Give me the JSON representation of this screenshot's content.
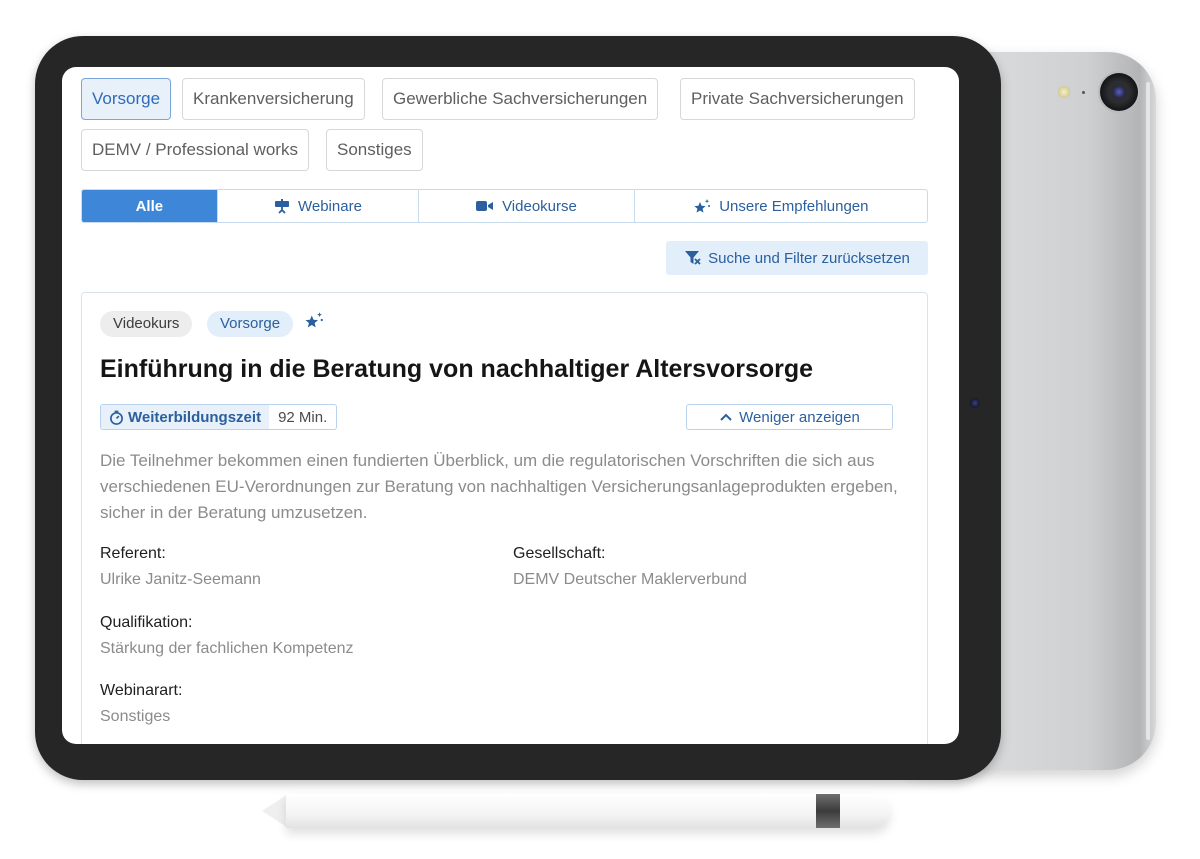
{
  "categories": [
    {
      "label": "Vorsorge",
      "active": true
    },
    {
      "label": "Krankenversicherung",
      "active": false
    },
    {
      "label": "Gewerbliche Sachversicherungen",
      "active": false
    },
    {
      "label": "Private Sachversicherungen",
      "active": false
    },
    {
      "label": "DEMV / Professional works",
      "active": false
    },
    {
      "label": "Sonstiges",
      "active": false
    }
  ],
  "tabs": [
    {
      "label": "Alle",
      "icon": "none",
      "active": true
    },
    {
      "label": "Webinare",
      "icon": "presentation-icon",
      "active": false
    },
    {
      "label": "Videokurse",
      "icon": "video-camera-icon",
      "active": false
    },
    {
      "label": "Unsere Empfehlungen",
      "icon": "sparkle-star-icon",
      "active": false
    }
  ],
  "reset_button": {
    "label": "Suche und Filter zurücksetzen",
    "icon": "filter-clear-icon"
  },
  "course": {
    "tags": [
      "Videokurs",
      "Vorsorge"
    ],
    "recommended_icon": "sparkle-star-icon",
    "title": "Einführung in die Beratung von nachhaltiger Altersvorsorge",
    "duration_label": "Weiterbildungszeit",
    "duration_value": "92 Min.",
    "toggle_label": "Weniger anzeigen",
    "description": "Die Teilnehmer bekommen einen fundierten Überblick, um die regulatorischen Vorschriften die sich aus verschiedenen EU-Verordnungen zur Beratung von nachhaltigen Versicherungsanlageprodukten ergeben, sicher in der Beratung umzusetzen.",
    "referent_label": "Referent:",
    "referent_value": "Ulrike Janitz-Seemann",
    "gesellschaft_label": "Gesellschaft:",
    "gesellschaft_value": "DEMV Deutscher Maklerverbund",
    "qualifikation_label": "Qualifikation:",
    "qualifikation_value": "Stärkung der fachlichen Kompetenz",
    "webinarart_label": "Webinarart:",
    "webinarart_value": "Sonstiges"
  },
  "colors": {
    "accent": "#3d86d8",
    "accent_text": "#2b5f9e",
    "accent_bg": "#e2eef9",
    "muted_text": "#8b8b8b"
  }
}
